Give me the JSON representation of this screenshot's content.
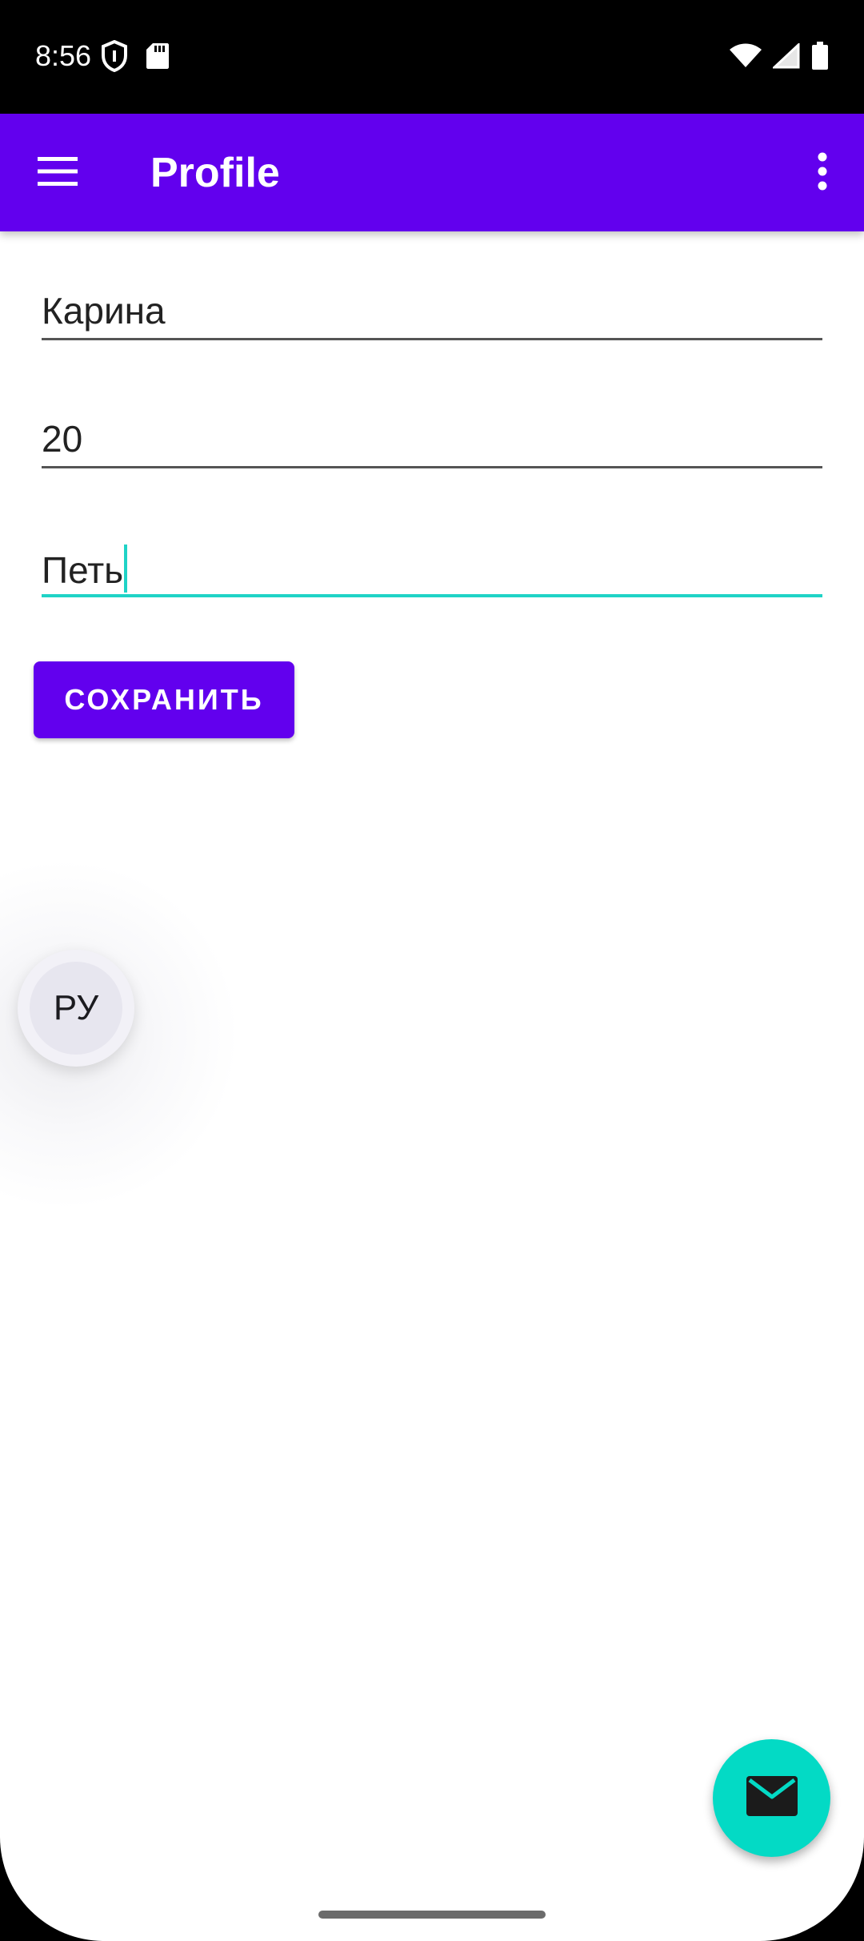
{
  "status_bar": {
    "time": "8:56",
    "left_icons": [
      "shield-icon",
      "sd-card-icon"
    ],
    "right_icons": [
      "wifi-icon",
      "cell-signal-icon",
      "battery-icon"
    ]
  },
  "toolbar": {
    "title": "Profile",
    "menu_icon": "hamburger-menu-icon",
    "overflow_icon": "more-vert-icon",
    "color": "#6200ee"
  },
  "form": {
    "name_value": "Карина",
    "age_value": "20",
    "third_value": "Петь",
    "focused_underline_color": "#1fd3c6"
  },
  "save_button": {
    "label": "СОХРАНИТЬ",
    "color": "#6200ee"
  },
  "language_bubble": {
    "label": "РУ"
  },
  "fab": {
    "icon": "mail-icon",
    "color": "#03dac5"
  }
}
